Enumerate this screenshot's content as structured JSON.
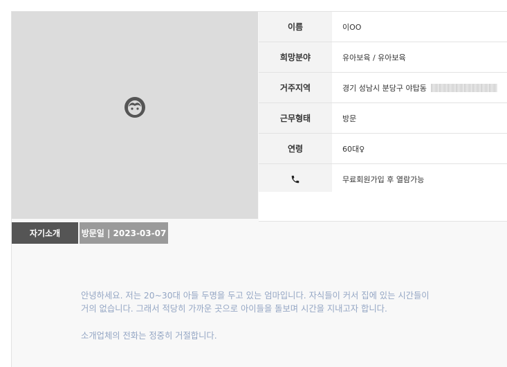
{
  "profile": {
    "fields": [
      {
        "label": "이름",
        "value": "이OO"
      },
      {
        "label": "희망분야",
        "value": "유아보육 / 유아보육"
      },
      {
        "label": "거주지역",
        "value": "경기 성남시 분당구 야탑동"
      },
      {
        "label": "근무형태",
        "value": "방문"
      },
      {
        "label": "연령",
        "value": "60대♀"
      },
      {
        "label": "phone-icon",
        "value": "무료회원가입 후 열람가능"
      }
    ]
  },
  "tabs": {
    "intro": "자기소개",
    "visit": "방문일 | 2023-03-07"
  },
  "intro": {
    "line1": "안녕하세요. 저는 20~30대 아들 두명을 두고 있는 엄마입니다. 자식들이 커서 집에 있는 시간들이",
    "line2": "거의 없습니다. 그래서 적당히 가까운 곳으로 아이들을 돌보며 시간을 지내고자 합니다.",
    "notice": "소개업체의 전화는 정중히 거절합니다."
  }
}
